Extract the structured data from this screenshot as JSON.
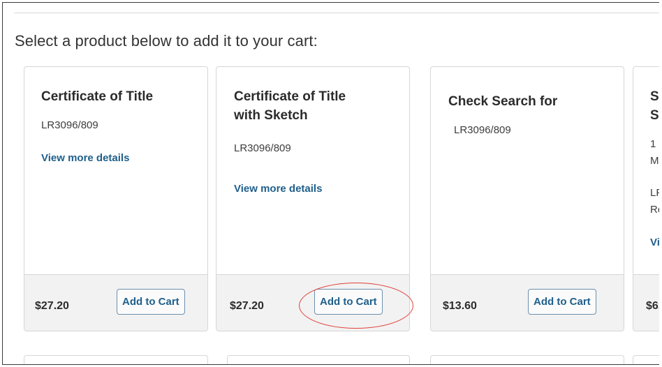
{
  "prompt": "Select a product below to add it to your cart:",
  "products": [
    {
      "title": "Certificate of Title",
      "code": "LR3096/809",
      "details_link": "View more details",
      "price": "$27.20",
      "button": "Add to Cart"
    },
    {
      "title_line1": "Certificate of Title",
      "title_line2": "with Sketch",
      "code": "LR3096/809",
      "details_link": "View more details",
      "price": "$27.20",
      "button": "Add to Cart",
      "highlighted": true
    },
    {
      "title": "Check Search for",
      "code": "LR3096/809",
      "price": "$13.60",
      "button": "Add to Cart"
    },
    {
      "title_line1": "S",
      "title_line2": "S",
      "line1": "1",
      "line2": "M",
      "line3": "LF",
      "line4": "Re",
      "details_link": "Vi",
      "price": "$6."
    }
  ],
  "colors": {
    "link": "#1f5f8b",
    "highlight_circle": "#e0413a",
    "footer_bg": "#f2f2f2"
  }
}
